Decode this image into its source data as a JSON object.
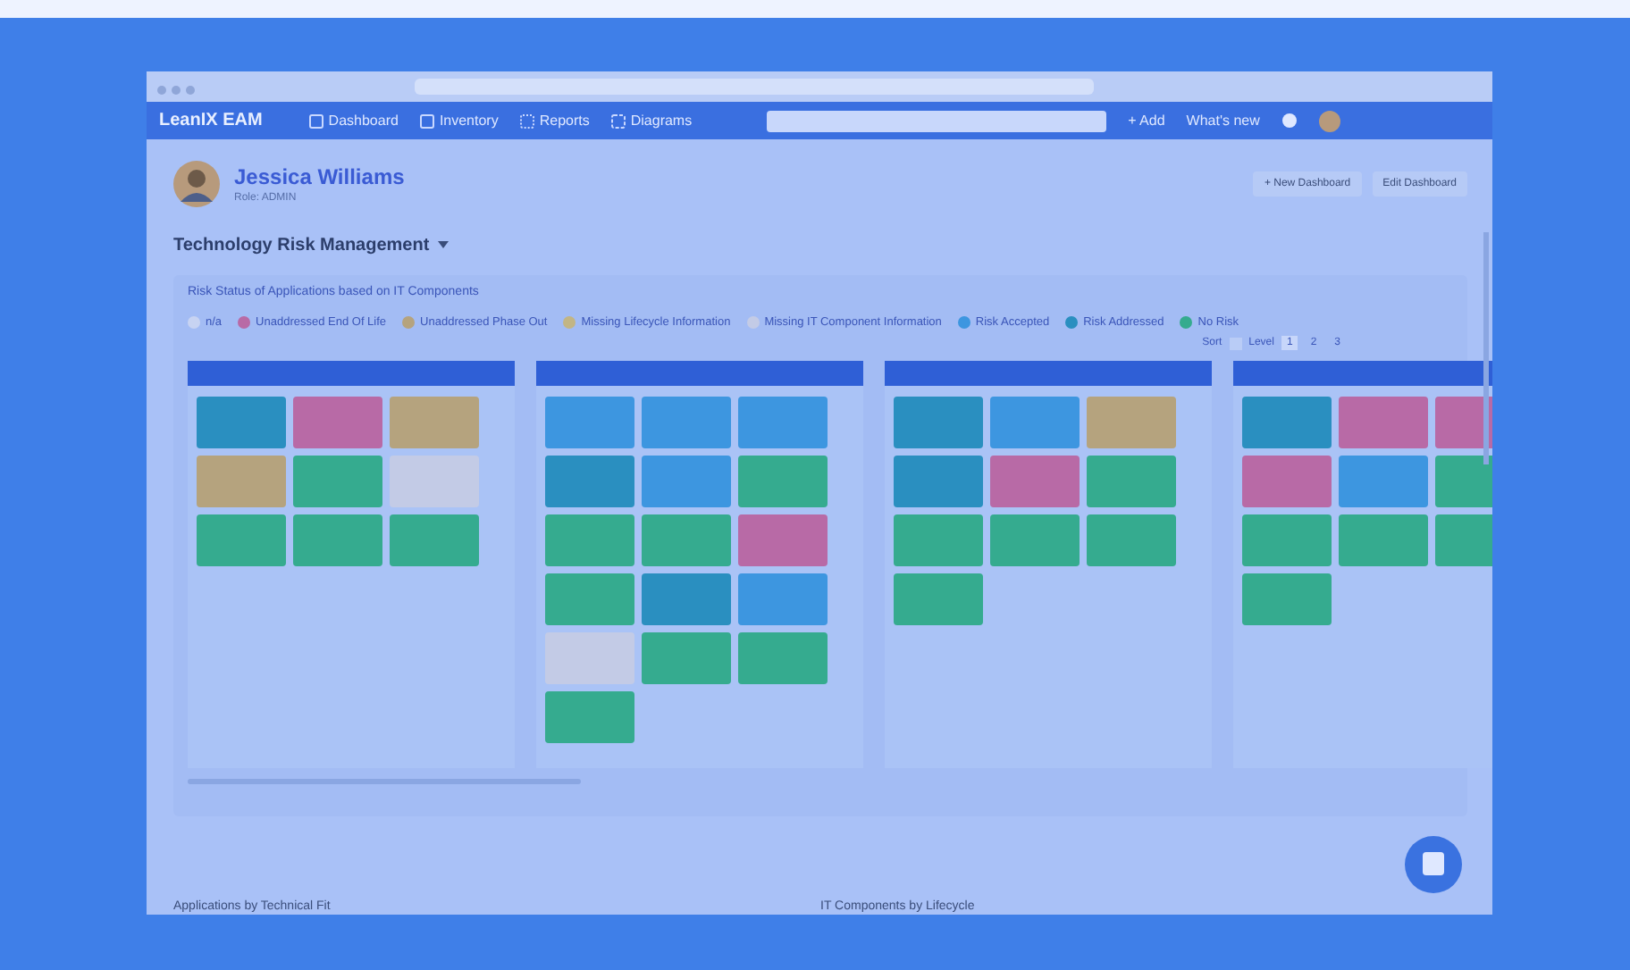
{
  "navbar": {
    "brand": "LeanIX EAM",
    "items": [
      "Dashboard",
      "Inventory",
      "Reports",
      "Diagrams"
    ],
    "add": "+ Add",
    "whats_new": "What's new"
  },
  "profile": {
    "name": "Jessica Williams",
    "role": "Role: ADMIN",
    "buttons": [
      "+ New Dashboard",
      "Edit Dashboard"
    ]
  },
  "dashboard_title": "Technology Risk Management",
  "report": {
    "title": "Risk Status of Applications based on IT Components",
    "legend": [
      {
        "label": "n/a",
        "color": "#c7d3f2"
      },
      {
        "label": "Unaddressed End Of Life",
        "color": "#b86aa6"
      },
      {
        "label": "Unaddressed Phase Out",
        "color": "#b5a37e"
      },
      {
        "label": "Missing Lifecycle Information",
        "color": "#c2b585"
      },
      {
        "label": "Missing IT Component Information",
        "color": "#c3cbe6"
      },
      {
        "label": "Risk Accepted",
        "color": "#3d96e0"
      },
      {
        "label": "Risk Addressed",
        "color": "#2a8fc0"
      },
      {
        "label": "No Risk",
        "color": "#35ab8f"
      }
    ],
    "sort_label": "Sort",
    "level_label": "Level",
    "levels": [
      {
        "label": "1",
        "selected": true
      },
      {
        "label": "2",
        "selected": false
      },
      {
        "label": "3",
        "selected": false
      }
    ],
    "columns": [
      {
        "tiles": [
          {
            "color": "#2a8fc0"
          },
          {
            "color": "#b86aa6"
          },
          {
            "color": "#b5a37e"
          },
          {
            "color": "#b5a37e"
          },
          {
            "color": "#35ab8f"
          },
          {
            "color": "#c3cbe6"
          },
          {
            "color": "#35ab8f"
          },
          {
            "color": "#35ab8f"
          },
          {
            "color": "#35ab8f"
          }
        ]
      },
      {
        "tiles": [
          {
            "color": "#3d96e0"
          },
          {
            "color": "#3d96e0"
          },
          {
            "color": "#3d96e0"
          },
          {
            "color": "#2a8fc0"
          },
          {
            "color": "#3d96e0"
          },
          {
            "color": "#35ab8f"
          },
          {
            "color": "#35ab8f"
          },
          {
            "color": "#35ab8f"
          },
          {
            "color": "#b86aa6"
          },
          {
            "color": "#35ab8f"
          },
          {
            "color": "#2a8fc0"
          },
          {
            "color": "#3d96e0"
          },
          {
            "color": "#c3cbe6"
          },
          {
            "color": "#35ab8f"
          },
          {
            "color": "#35ab8f"
          },
          {
            "color": "#35ab8f"
          }
        ]
      },
      {
        "tiles": [
          {
            "color": "#2a8fc0"
          },
          {
            "color": "#3d96e0"
          },
          {
            "color": "#b5a37e"
          },
          {
            "color": "#2a8fc0"
          },
          {
            "color": "#b86aa6"
          },
          {
            "color": "#35ab8f"
          },
          {
            "color": "#35ab8f"
          },
          {
            "color": "#35ab8f"
          },
          {
            "color": "#35ab8f"
          },
          {
            "color": "#35ab8f"
          }
        ]
      },
      {
        "tiles": [
          {
            "color": "#2a8fc0"
          },
          {
            "color": "#b86aa6"
          },
          {
            "color": "#b86aa6"
          },
          {
            "color": "#b86aa6"
          },
          {
            "color": "#3d96e0"
          },
          {
            "color": "#35ab8f"
          },
          {
            "color": "#35ab8f"
          },
          {
            "color": "#35ab8f"
          },
          {
            "color": "#35ab8f"
          },
          {
            "color": "#35ab8f"
          }
        ]
      }
    ]
  },
  "bottom_reports": [
    "Applications by Technical Fit",
    "IT Components by Lifecycle"
  ]
}
